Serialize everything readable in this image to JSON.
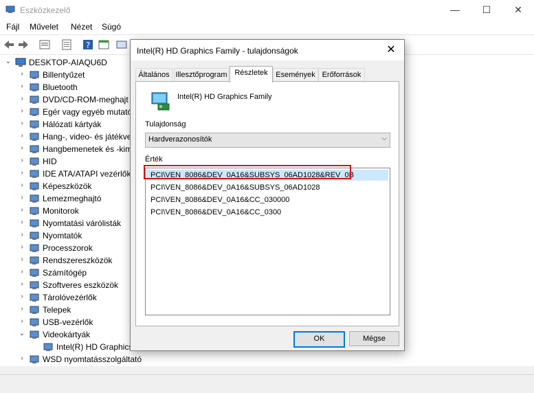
{
  "window": {
    "title": "Eszközkezelő",
    "controls": {
      "minimize": "—",
      "maximize": "☐",
      "close": "✕"
    }
  },
  "menu": [
    "Fájl",
    "Művelet",
    "Nézet",
    "Súgó"
  ],
  "tree": {
    "root": "DESKTOP-AIAQU6D",
    "items": [
      {
        "label": "Billentyűzet",
        "icon": "keyboard-icon"
      },
      {
        "label": "Bluetooth",
        "icon": "bluetooth-icon"
      },
      {
        "label": "DVD/CD-ROM-meghajt",
        "icon": "dvd-icon"
      },
      {
        "label": "Egér vagy egyéb mutató",
        "icon": "mouse-icon"
      },
      {
        "label": "Hálózati kártyák",
        "icon": "network-icon"
      },
      {
        "label": "Hang-, video- és játékve",
        "icon": "sound-icon"
      },
      {
        "label": "Hangbemenetek és -kim",
        "icon": "audio-io-icon"
      },
      {
        "label": "HID",
        "icon": "hid-icon"
      },
      {
        "label": "IDE ATA/ATAPI vezérlők",
        "icon": "ide-icon"
      },
      {
        "label": "Képeszközök",
        "icon": "camera-icon"
      },
      {
        "label": "Lemezmeghajtó",
        "icon": "disk-icon"
      },
      {
        "label": "Monitorok",
        "icon": "monitor-icon"
      },
      {
        "label": "Nyomtatási várólisták",
        "icon": "print-queue-icon"
      },
      {
        "label": "Nyomtatók",
        "icon": "printer-icon"
      },
      {
        "label": "Processzorok",
        "icon": "cpu-icon"
      },
      {
        "label": "Rendszereszközök",
        "icon": "system-icon"
      },
      {
        "label": "Számítógép",
        "icon": "computer-icon"
      },
      {
        "label": "Szoftveres eszközök",
        "icon": "software-icon"
      },
      {
        "label": "Tárolóvezérlők",
        "icon": "storage-icon"
      },
      {
        "label": "Telepek",
        "icon": "battery-icon"
      },
      {
        "label": "USB-vezérlők",
        "icon": "usb-icon"
      },
      {
        "label": "Videokártyák",
        "icon": "display-adapter-icon"
      },
      {
        "label": "Intel(R) HD Graphics",
        "icon": "display-adapter-icon"
      },
      {
        "label": "WSD nyomtatásszolgáltató",
        "icon": "wsd-icon"
      }
    ]
  },
  "dialog": {
    "title": "Intel(R) HD Graphics Family - tulajdonságok",
    "close": "✕",
    "tabs": [
      "Általános",
      "Illesztőprogram",
      "Részletek",
      "Események",
      "Erőforrások"
    ],
    "device_name": "Intel(R) HD Graphics Family",
    "property_label": "Tulajdonság",
    "property_value": "Hardverazonosítók",
    "value_label": "Érték",
    "values": [
      "PCI\\VEN_8086&DEV_0A16&SUBSYS_06AD1028&REV_0B",
      "PCI\\VEN_8086&DEV_0A16&SUBSYS_06AD1028",
      "PCI\\VEN_8086&DEV_0A16&CC_030000",
      "PCI\\VEN_8086&DEV_0A16&CC_0300"
    ],
    "ok": "OK",
    "cancel": "Mégse"
  },
  "colors": {
    "selection": "#cce8ff",
    "highlight_border": "#d0161c",
    "default_button": "#0078d7"
  }
}
